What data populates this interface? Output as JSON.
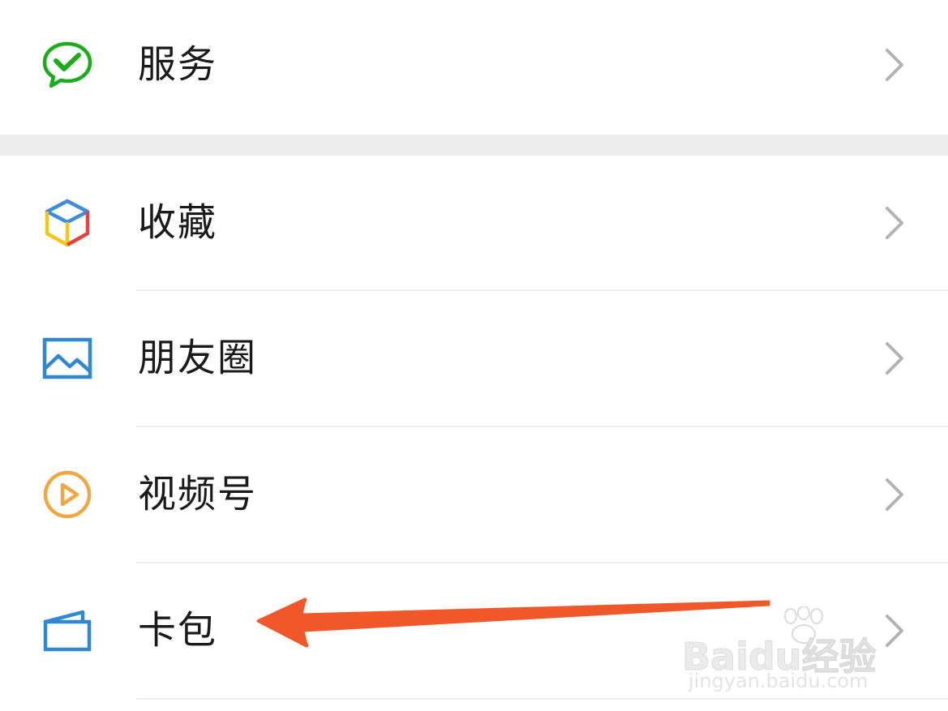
{
  "menu": {
    "items": [
      {
        "id": "services",
        "label": "服务",
        "icon": "wechat-pay-check-icon"
      },
      {
        "id": "favorites",
        "label": "收藏",
        "icon": "cube-icon"
      },
      {
        "id": "moments",
        "label": "朋友圈",
        "icon": "landscape-image-icon"
      },
      {
        "id": "channels",
        "label": "视频号",
        "icon": "play-circle-icon"
      },
      {
        "id": "card-wallet",
        "label": "卡包",
        "icon": "wallet-icon"
      }
    ]
  },
  "colors": {
    "services_icon": "#1aad19",
    "favorites_blue": "#3b8de0",
    "favorites_yellow": "#f5c518",
    "favorites_red": "#e64340",
    "moments_icon": "#2f88d6",
    "channels_icon": "#f0a742",
    "wallet_icon": "#2f88d6",
    "chevron": "#b2b2b2",
    "annotation_arrow": "#f0582a"
  },
  "watermark": {
    "main": "Baidu经验",
    "sub": "jingyan.baidu.com"
  }
}
